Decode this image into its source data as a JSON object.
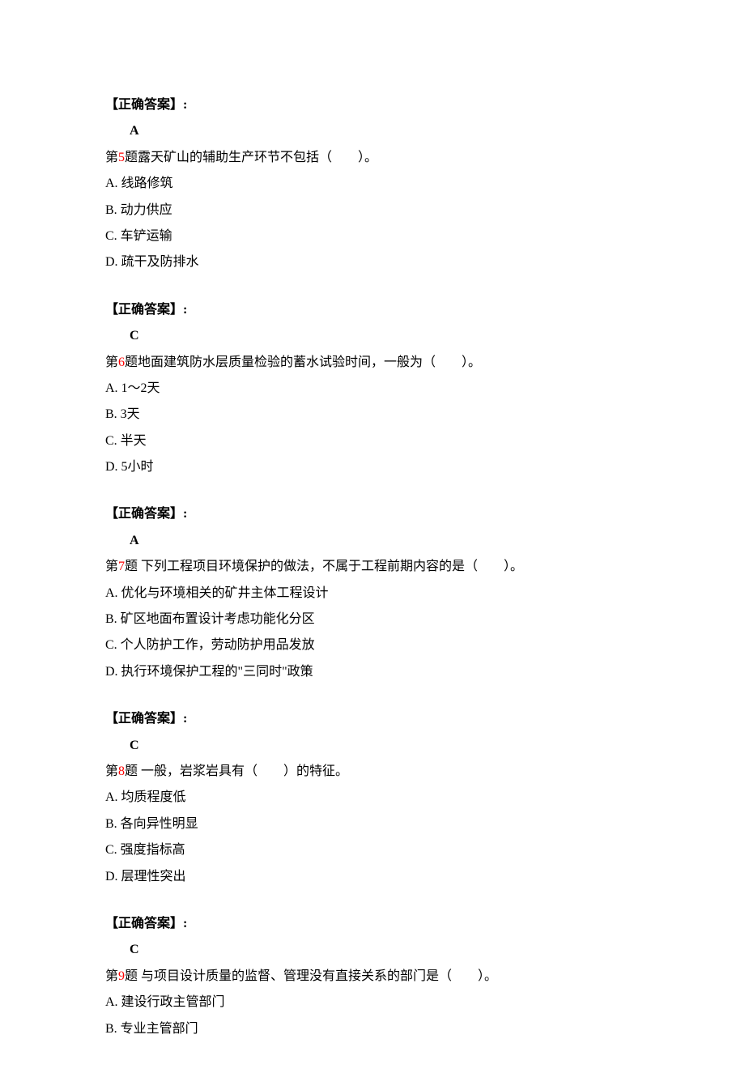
{
  "labels": {
    "answer_heading": "【正确答案】:",
    "question_prefix": "第",
    "question_suffix": "题"
  },
  "blocks": [
    {
      "type": "answer",
      "value": "A"
    },
    {
      "type": "question",
      "number": "5",
      "text": "露天矿山的辅助生产环节不包括（　　）。",
      "options": [
        "A. 线路修筑",
        "B. 动力供应",
        "C. 车铲运输",
        "D. 疏干及防排水"
      ]
    },
    {
      "type": "answer",
      "value": "C"
    },
    {
      "type": "question",
      "number": "6",
      "text": "地面建筑防水层质量检验的蓄水试验时间，一般为（　　）。",
      "options": [
        "A. 1～2天",
        "B. 3天",
        "C. 半天",
        "D. 5小时"
      ]
    },
    {
      "type": "answer",
      "value": "A"
    },
    {
      "type": "question",
      "number": "7",
      "text": " 下列工程项目环境保护的做法，不属于工程前期内容的是（　　）。",
      "options": [
        "A. 优化与环境相关的矿井主体工程设计",
        "B. 矿区地面布置设计考虑功能化分区",
        "C. 个人防护工作，劳动防护用品发放",
        "D. 执行环境保护工程的\"三同时\"政策"
      ]
    },
    {
      "type": "answer",
      "value": "C"
    },
    {
      "type": "question",
      "number": "8",
      "text": " 一般，岩浆岩具有（　　）的特征。",
      "options": [
        "A. 均质程度低",
        "B. 各向异性明显",
        "C. 强度指标高",
        "D. 层理性突出"
      ]
    },
    {
      "type": "answer",
      "value": "C"
    },
    {
      "type": "question",
      "number": "9",
      "text": " 与项目设计质量的监督、管理没有直接关系的部门是（　　）。",
      "options": [
        "A. 建设行政主管部门",
        "B. 专业主管部门"
      ]
    }
  ]
}
